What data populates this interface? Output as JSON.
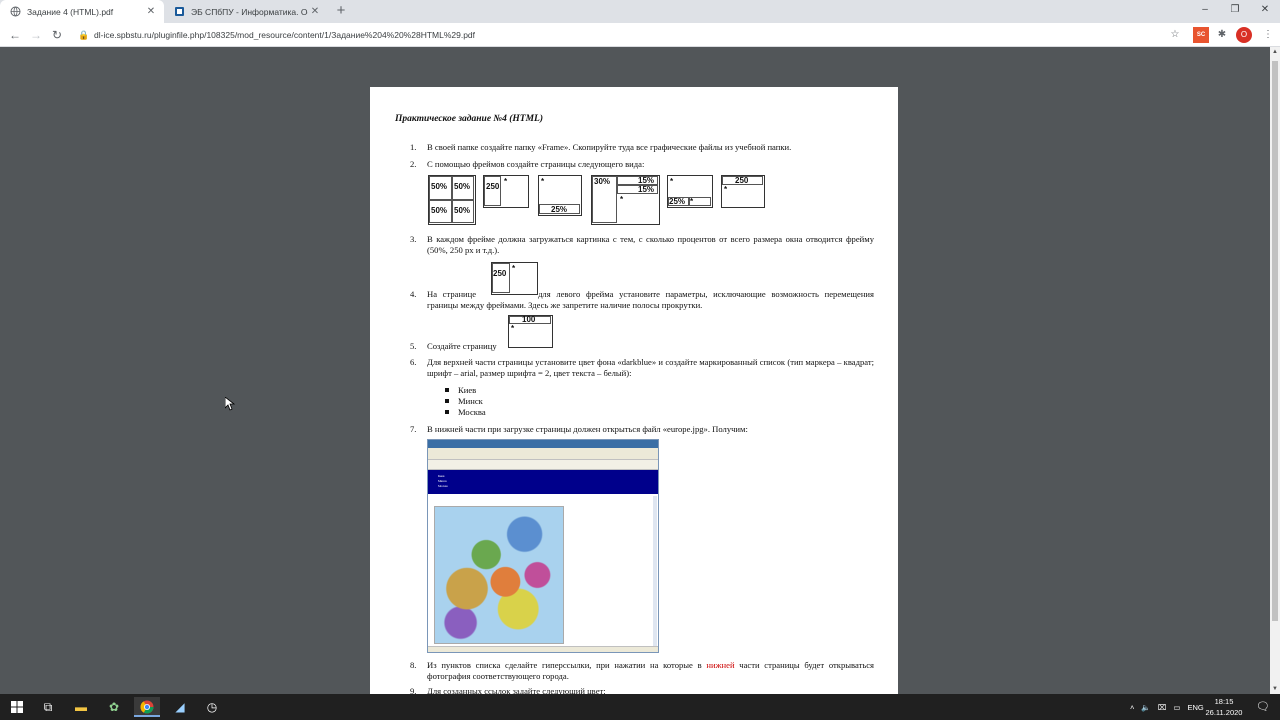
{
  "browser": {
    "tabs": [
      {
        "title": "Задание 4 (HTML).pdf",
        "active": true
      },
      {
        "title": "ЭБ СПбПУ - Информатика. Осн...",
        "active": false
      }
    ],
    "new_tab": "+",
    "window_buttons": {
      "minimize": "–",
      "maximize": "❐",
      "close": "✕"
    },
    "url": "dl-ice.spbstu.ru/pluginfile.php/108325/mod_resource/content/1/Задание%204%20%28HTML%29.pdf",
    "profile_initial": "О",
    "ext_badge": "SC"
  },
  "document": {
    "title": "Практическое задание №4 (HTML)",
    "items": [
      {
        "num": "1.",
        "text": "В своей папке создайте папку «Frame». Скопируйте туда все графические файлы из учебной папки."
      },
      {
        "num": "2.",
        "text": "С помощью фреймов создайте страницы следующего вида:"
      },
      {
        "num": "3.",
        "text": "В каждом фрейме должна загружаться картинка с тем, с сколько процентов от всего размера окна отводится фрейму (50%, 250 px и т.д.)."
      },
      {
        "num": "4.",
        "text_before": "На странице",
        "text_after": "для левого фрейма установите параметры, исключающие возможность перемещения границы между фреймами. Здесь же запретите наличие полосы прокрутки."
      },
      {
        "num": "5.",
        "text": "Создайте страницу"
      },
      {
        "num": "6.",
        "text": "Для верхней части страницы установите цвет фона «darkblue» и создайте маркированный список (тип маркера – квадрат; шрифт – arial, размер шрифта = 2, цвет текста – белый):"
      },
      {
        "num": "7.",
        "text": "В нижней части при загрузке страницы должен открыться файл «europe.jpg». Получим:"
      },
      {
        "num": "8.",
        "text_before": "Из пунктов списка сделайте гиперссылки, при нажатии на которые в",
        "text_red": "нижней",
        "text_after": "части страницы будет открываться фотография соответствующего города."
      },
      {
        "num": "9.",
        "text": "Для созданных ссылок задайте следующий цвет:"
      }
    ],
    "cities": [
      "Киев",
      "Минск",
      "Москва"
    ],
    "diagram_labels": {
      "d1": [
        "50%",
        "50%",
        "50%",
        "50%"
      ],
      "d2": [
        "250",
        "*"
      ],
      "d3": [
        "*",
        "25%"
      ],
      "d4": [
        "30%",
        "15%",
        "15%",
        "*"
      ],
      "d5": [
        "*",
        "25%",
        "*"
      ],
      "d6": [
        "250",
        "*"
      ],
      "i4": [
        "250",
        "*"
      ],
      "i5": [
        "100",
        "*"
      ]
    },
    "shot_list": [
      "Киев",
      "Минск",
      "Москва"
    ]
  },
  "taskbar": {
    "lang": "ENG",
    "time": "18:15",
    "date": "26.11.2020"
  }
}
